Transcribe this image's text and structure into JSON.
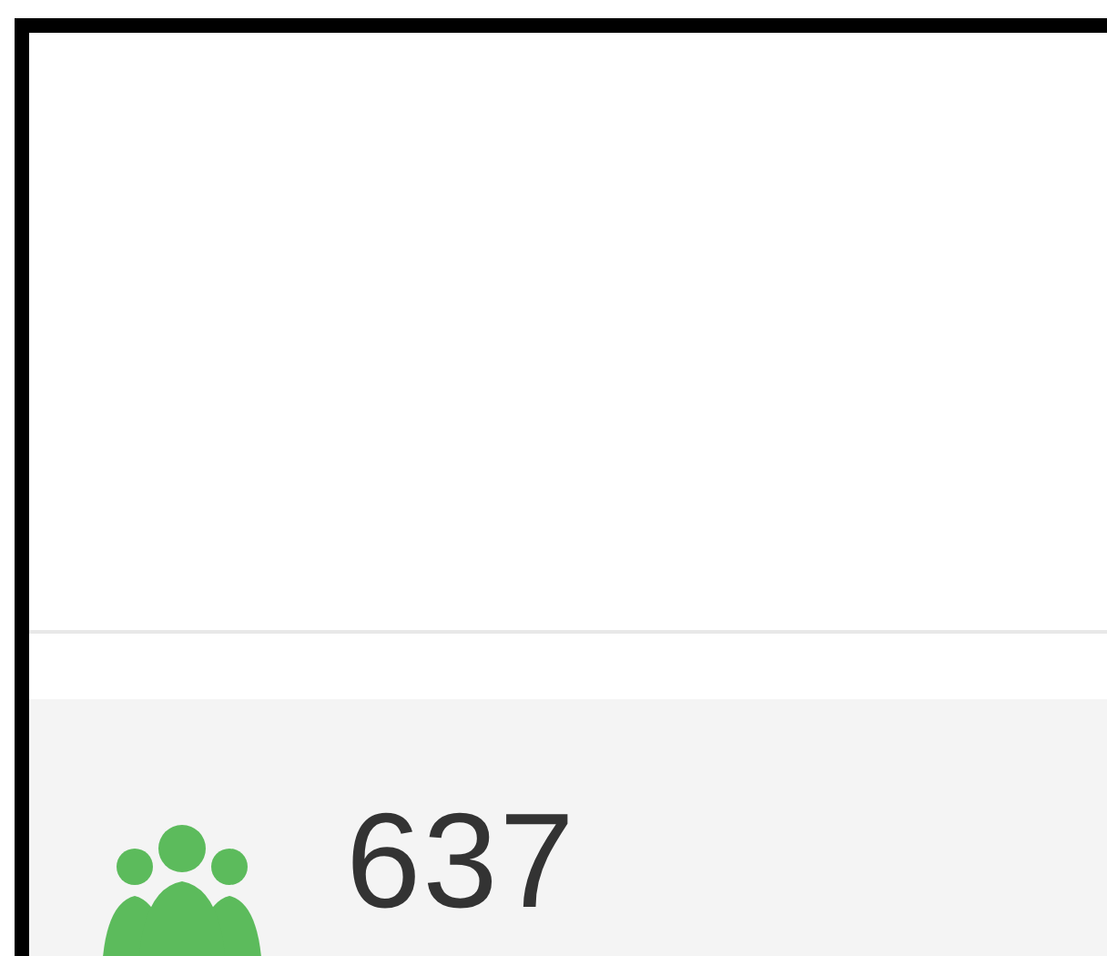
{
  "stat": {
    "count": "637"
  }
}
